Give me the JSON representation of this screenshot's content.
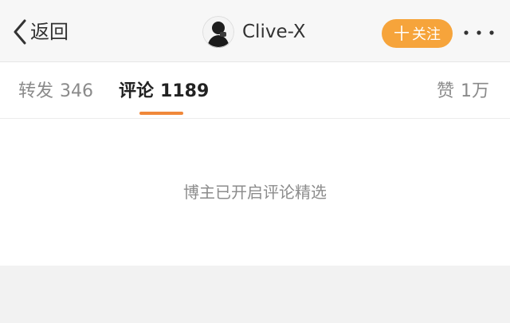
{
  "nav": {
    "back_label": "返回",
    "username": "Clive-X",
    "follow_label": "关注",
    "follow_plus": "十",
    "accent_color": "#f6a43b"
  },
  "tabs": {
    "repost": {
      "label": "转发",
      "count": "346"
    },
    "comment": {
      "label": "评论",
      "count": "1189",
      "active": true
    },
    "like": {
      "label": "赞",
      "count": "1万"
    },
    "indicator_color": "#f0883a"
  },
  "content": {
    "notice": "博主已开启评论精选"
  },
  "icons": {
    "back": "chevron-left-icon",
    "more": "more-dots-icon"
  }
}
